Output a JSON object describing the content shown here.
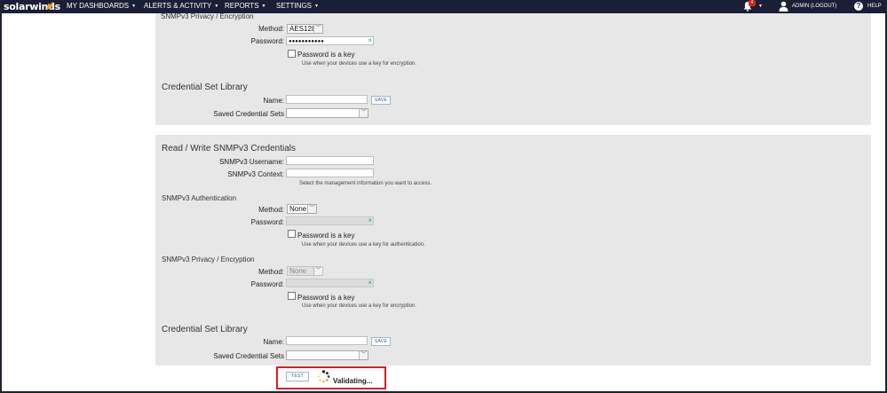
{
  "nav": {
    "logo": "solarwinds",
    "items": [
      {
        "label": "MY DASHBOARDS"
      },
      {
        "label": "ALERTS & ACTIVITY"
      },
      {
        "label": "REPORTS"
      },
      {
        "label": "SETTINGS"
      }
    ],
    "notification_count": "4",
    "user_label": "ADMIN  (LOGOUT)",
    "help_label": "HELP",
    "help_glyph": "?"
  },
  "panel1": {
    "privacy_title": "SNMPv3 Privacy / Encryption",
    "method_label": "Method:",
    "method_value": "AES128",
    "password_label": "Password:",
    "password_value": "●●●●●●●●●●●",
    "password_is_key": "Password is a key",
    "password_hint": "Use when your devices use a key for encryption.",
    "library_title": "Credential Set Library",
    "name_label": "Name:",
    "name_value": "",
    "save_label": "SAVE",
    "saved_sets_label": "Saved Credential Sets",
    "saved_sets_value": ""
  },
  "panel2": {
    "title": "Read / Write SNMPv3 Credentials",
    "username_label": "SNMPv3 Username:",
    "username_value": "",
    "context_label": "SNMPv3 Context:",
    "context_value": "",
    "context_hint": "Select the management information you want to access.",
    "auth_title": "SNMPv3 Authentication",
    "auth_method_label": "Method:",
    "auth_method_value": "None",
    "auth_password_label": "Password:",
    "auth_password_value": "",
    "auth_is_key": "Password is a key",
    "auth_hint": "Use when your devices use a key for authentication.",
    "privacy_title": "SNMPv3 Privacy / Encryption",
    "priv_method_label": "Method:",
    "priv_method_value": "None",
    "priv_password_label": "Password:",
    "priv_password_value": "",
    "priv_is_key": "Password is a key",
    "priv_hint": "Use when your devices use a key for encryption.",
    "library_title": "Credential Set Library",
    "name_label": "Name:",
    "name_value": "",
    "save_label": "SAVE",
    "saved_sets_label": "Saved Credential Sets",
    "saved_sets_value": ""
  },
  "footer": {
    "test_label": "TEST",
    "validating_text": "Validating..."
  },
  "icons": {
    "clear": "×",
    "caret": "▼",
    "select_arrow": "﹀"
  },
  "colors": {
    "nav_bg": "#1a1f36",
    "panel_bg": "#e7e7e7",
    "highlight_border": "#e01b24",
    "badge": "#e2231a",
    "logo_accent": "#f4a51c"
  }
}
